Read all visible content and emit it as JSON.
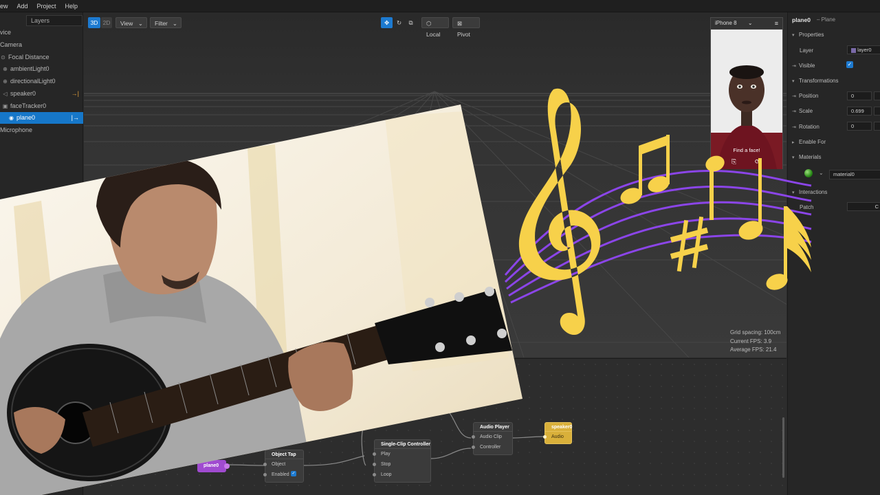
{
  "menu": [
    "ew",
    "Add",
    "Project",
    "Help"
  ],
  "scene": {
    "layers_tab": "Layers",
    "items": [
      {
        "label": "vice",
        "icon": "none"
      },
      {
        "label": "Camera",
        "icon": "none"
      },
      {
        "label": "Focal Distance",
        "icon": "target-icon"
      },
      {
        "label": "ambientLight0",
        "icon": "globe-icon"
      },
      {
        "label": "directionalLight0",
        "icon": "globe-icon"
      },
      {
        "label": "speaker0",
        "icon": "speaker-icon"
      },
      {
        "label": "faceTracker0",
        "icon": "face-icon"
      },
      {
        "label": "plane0",
        "icon": "eye-icon"
      },
      {
        "label": "Microphone",
        "icon": "none"
      }
    ]
  },
  "viewport": {
    "btn_3d": "3D",
    "btn_2d": "2D",
    "view_menu": "View",
    "filter_menu": "Filter",
    "local_btn": "Local",
    "pivot_btn": "Pivot",
    "grid_spacing": "Grid spacing: 100cm",
    "current_fps": "Current FPS:  3.9",
    "average_fps": "Average FPS:  21.4"
  },
  "device": {
    "name": "iPhone 8",
    "prompt": "Find a face!"
  },
  "inspector": {
    "title": "plane0",
    "subtitle": "– Plane",
    "properties": "Properties",
    "layer_label": "Layer",
    "layer_value": "layer0",
    "visible_label": "Visible",
    "transformations": "Transformations",
    "position_label": "Position",
    "position_value": "0",
    "scale_label": "Scale",
    "scale_value": "0.699",
    "rotation_label": "Rotation",
    "rotation_value": "0",
    "enable_for": "Enable For",
    "materials": "Materials",
    "material_value": "material0",
    "interactions": "Interactions",
    "patch_label": "Patch",
    "patch_value": "C"
  },
  "patch": {
    "plane_pill": "plane0",
    "object_tap": {
      "title": "Object Tap",
      "ports": [
        "Object",
        "Enabled"
      ]
    },
    "controller": {
      "title": "Single-Clip Controller",
      "ports": [
        "Play",
        "Stop",
        "Loop"
      ]
    },
    "audio_player": {
      "title": "Audio Player",
      "ports": [
        "Audio Clip",
        "Controller"
      ]
    },
    "speaker": {
      "title": "speaker0",
      "ports": [
        "Audio"
      ]
    }
  },
  "colors": {
    "accent_blue": "#1d7ad0",
    "music_yellow": "#f7d14a",
    "staff_purple": "#8b45e8",
    "patch_pill_purple": "#a04bd0",
    "speaker_node_yellow": "#d9b03a"
  }
}
